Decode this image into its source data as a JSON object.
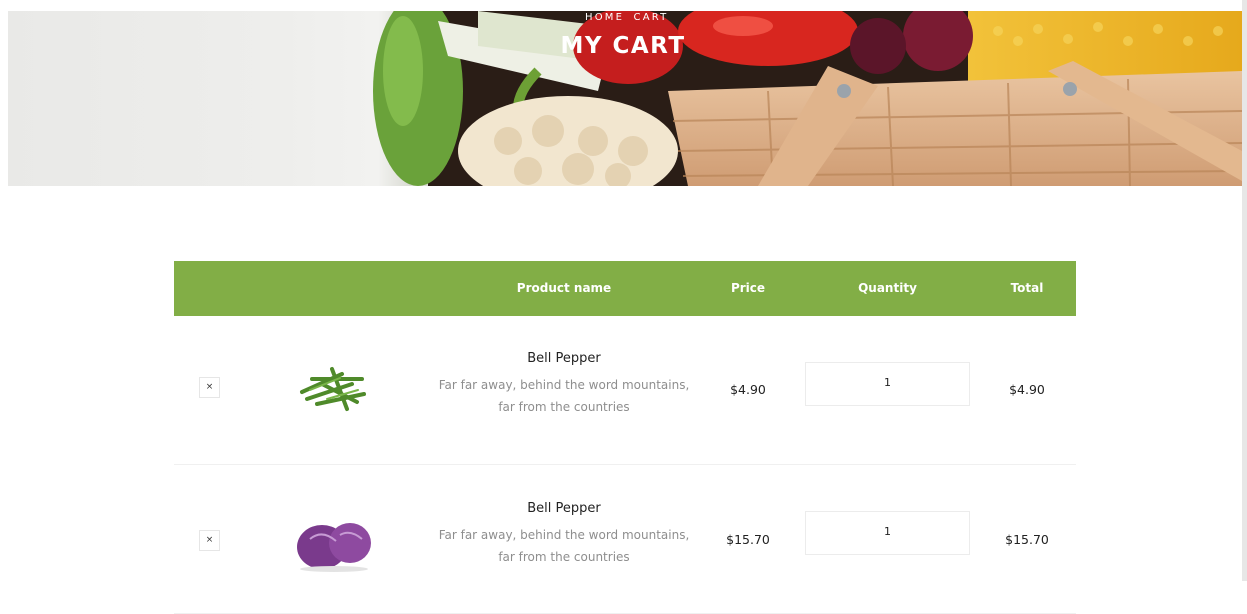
{
  "hero": {
    "breadcrumb": [
      "HOME",
      "CART"
    ],
    "title": "MY CART"
  },
  "table": {
    "headers": {
      "product_name": "Product name",
      "price": "Price",
      "quantity": "Quantity",
      "total": "Total"
    },
    "rows": [
      {
        "remove": "×",
        "name": "Bell Pepper",
        "desc_line1": "Far far away, behind the word mountains,",
        "desc_line2": "far from the countries",
        "price": "$4.90",
        "quantity": "1",
        "total": "$4.90",
        "image": "green-beans-image"
      },
      {
        "remove": "×",
        "name": "Bell Pepper",
        "desc_line1": "Far far away, behind the word mountains,",
        "desc_line2": "far from the countries",
        "price": "$15.70",
        "quantity": "1",
        "total": "$15.70",
        "image": "red-cabbage-image"
      }
    ]
  },
  "colors": {
    "accent": "#82ae46",
    "muted_text": "#8e8e8e"
  }
}
